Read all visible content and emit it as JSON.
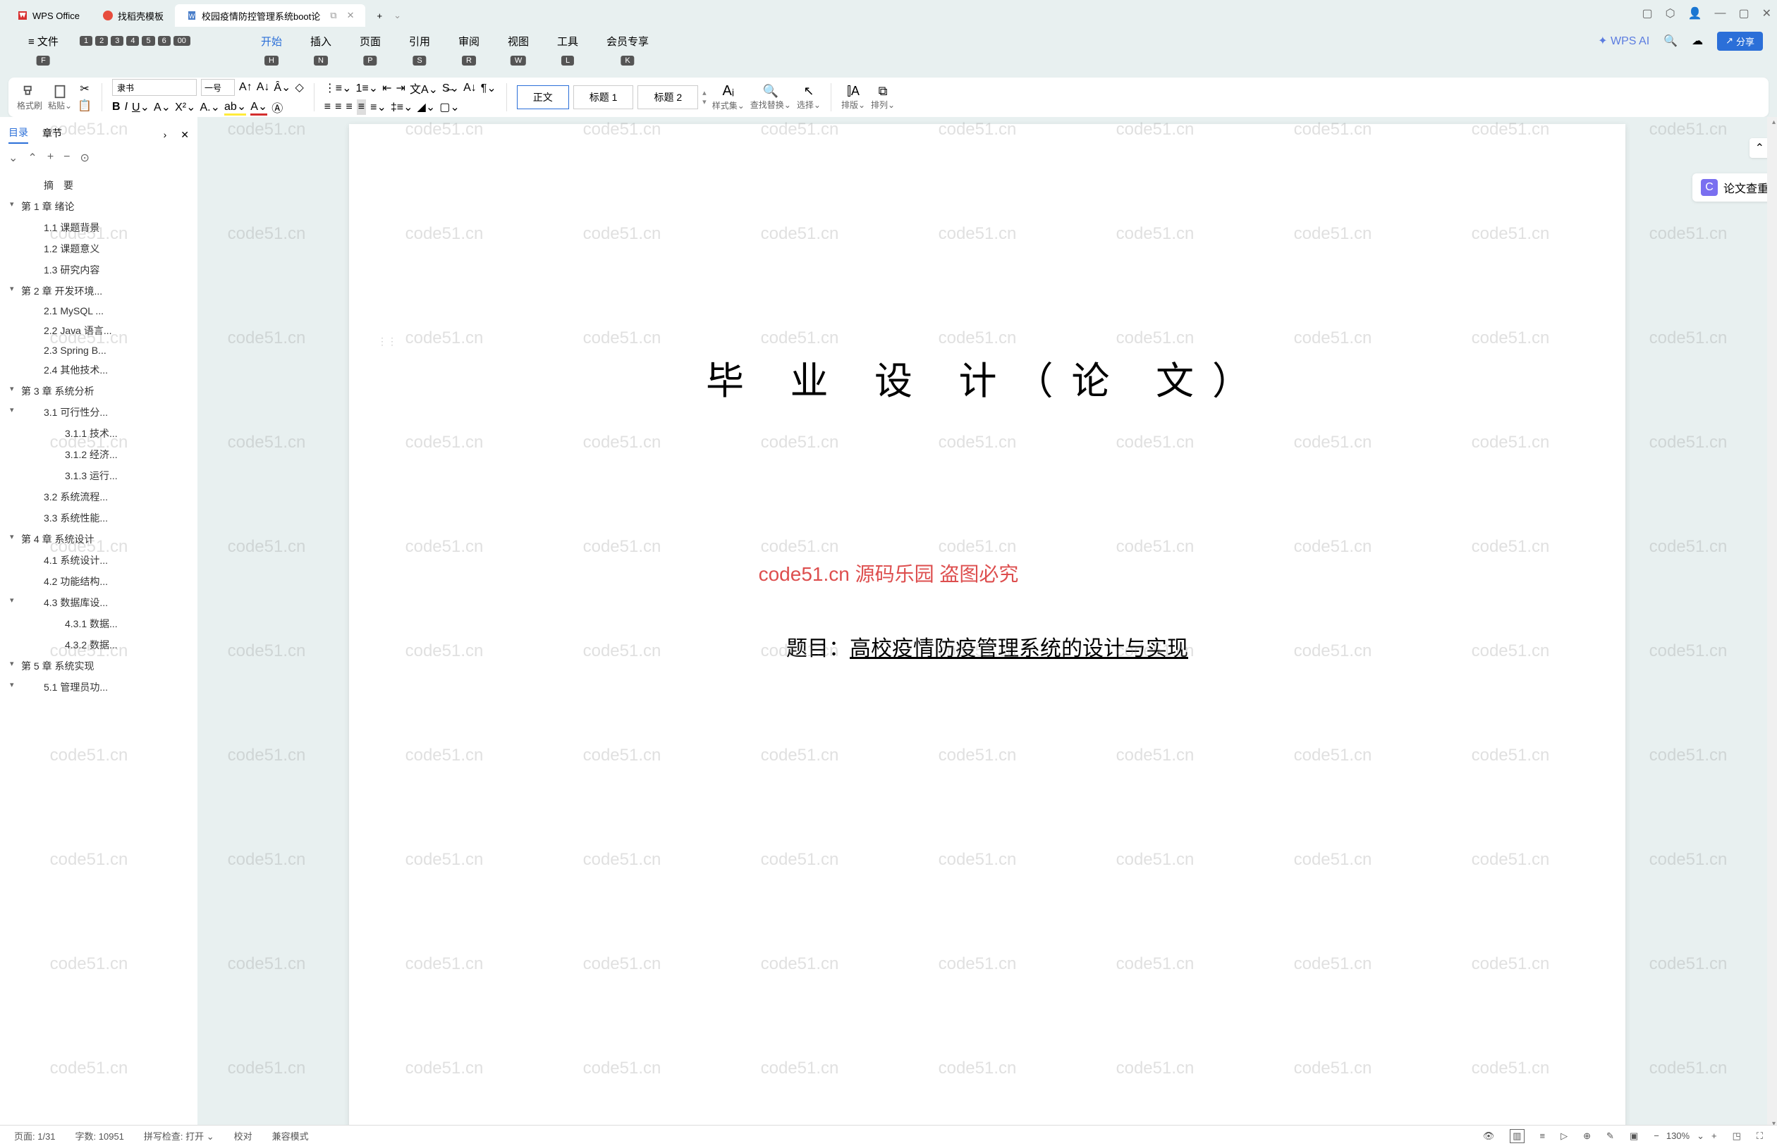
{
  "titlebar": {
    "app": "WPS Office",
    "tab2": "找稻壳模板",
    "tab3": "校园疫情防控管理系统boot论",
    "add": "+"
  },
  "menu": {
    "file": "文件",
    "file_k": "F",
    "start": "开始",
    "start_k": "H",
    "insert": "插入",
    "insert_k": "N",
    "page": "页面",
    "page_k": "P",
    "ref": "引用",
    "ref_k": "S",
    "review": "审阅",
    "review_k": "R",
    "view": "视图",
    "view_k": "W",
    "tool": "工具",
    "tool_k": "L",
    "vip": "会员专享",
    "vip_k": "K",
    "ai": "WPS AI",
    "share": "分享",
    "num1": "1",
    "num2": "2",
    "num3": "3",
    "num4": "4",
    "num5": "5",
    "num6": "6",
    "num00": "00"
  },
  "toolbar": {
    "format_brush": "格式刷",
    "paste": "粘贴",
    "font": "隶书",
    "size": "一号",
    "style_body": "正文",
    "style_h1": "标题 1",
    "style_h2": "标题 2",
    "styleset": "样式集",
    "findrepl": "查找替换",
    "select": "选择",
    "layout": "排版",
    "arrange": "排列"
  },
  "sidebar": {
    "toc": "目录",
    "chapter": "章节",
    "abstract_label": "摘　要",
    "items": [
      {
        "lvl": 0,
        "chev": true,
        "t": "第 1 章  绪论"
      },
      {
        "lvl": 1,
        "t": "1.1  课题背景"
      },
      {
        "lvl": 1,
        "t": "1.2  课题意义"
      },
      {
        "lvl": 1,
        "t": "1.3  研究内容"
      },
      {
        "lvl": 0,
        "chev": true,
        "t": "第 2 章  开发环境..."
      },
      {
        "lvl": 1,
        "t": "2.1 MySQL ..."
      },
      {
        "lvl": 1,
        "t": "2.2 Java 语言..."
      },
      {
        "lvl": 1,
        "t": "2.3 Spring B..."
      },
      {
        "lvl": 1,
        "t": "2.4 其他技术..."
      },
      {
        "lvl": 0,
        "chev": true,
        "t": "第 3 章  系统分析"
      },
      {
        "lvl": 1,
        "chev": true,
        "t": "3.1 可行性分..."
      },
      {
        "lvl": 2,
        "t": "3.1.1 技术..."
      },
      {
        "lvl": 2,
        "t": "3.1.2 经济..."
      },
      {
        "lvl": 2,
        "t": "3.1.3 运行..."
      },
      {
        "lvl": 1,
        "t": "3.2 系统流程..."
      },
      {
        "lvl": 1,
        "t": "3.3 系统性能..."
      },
      {
        "lvl": 0,
        "chev": true,
        "t": "第 4 章  系统设计"
      },
      {
        "lvl": 1,
        "t": "4.1  系统设计..."
      },
      {
        "lvl": 1,
        "t": "4.2  功能结构..."
      },
      {
        "lvl": 1,
        "chev": true,
        "t": "4.3  数据库设..."
      },
      {
        "lvl": 2,
        "t": "4.3.1  数据..."
      },
      {
        "lvl": 2,
        "t": "4.3.2  数据..."
      },
      {
        "lvl": 0,
        "chev": true,
        "t": "第 5 章  系统实现"
      },
      {
        "lvl": 1,
        "chev": true,
        "t": "5.1  管理员功..."
      }
    ]
  },
  "doc": {
    "title": "毕 业 设 计（论 文）",
    "subject_label": "题目：",
    "subject": "高校疫情防疫管理系统的设计与实现"
  },
  "side": {
    "check": "论文查重"
  },
  "status": {
    "page": "页面: 1/31",
    "words": "字数: 10951",
    "spell": "拼写检查: 打开",
    "proof": "校对",
    "compat": "兼容模式",
    "zoom": "130%"
  },
  "watermark": {
    "text": "code51.cn",
    "center": "code51.cn  源码乐园 盗图必究"
  }
}
